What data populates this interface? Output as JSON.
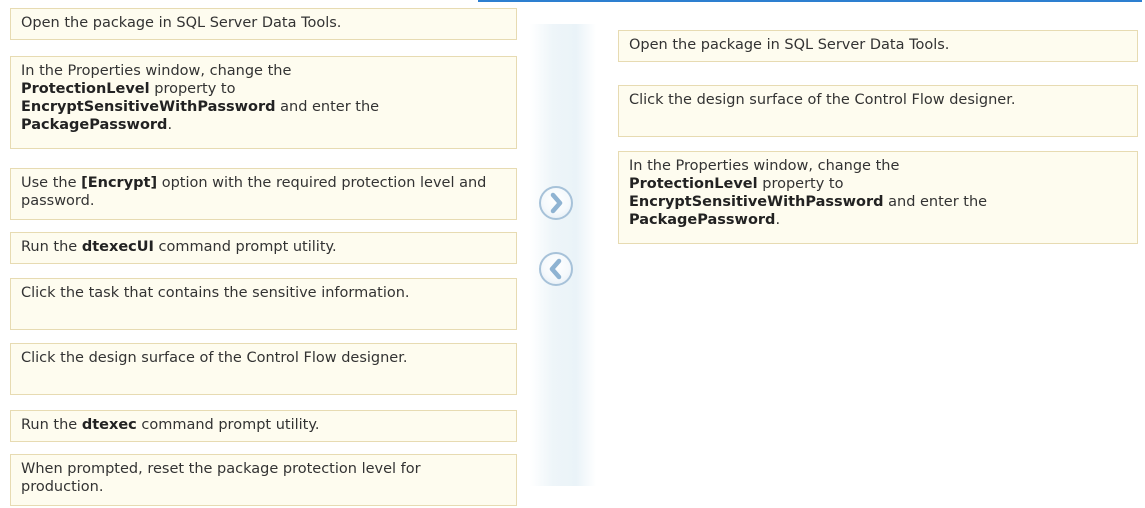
{
  "left_options": [
    {
      "parts": [
        {
          "t": "Open the package in SQL Server Data Tools.",
          "b": false
        }
      ]
    },
    {
      "parts": [
        {
          "t": "In the Properties window, change the ",
          "b": false
        },
        {
          "t": "ProtectionLevel",
          "b": true
        },
        {
          "t": " property to ",
          "b": false
        },
        {
          "t": "EncryptSensitiveWithPassword",
          "b": true
        },
        {
          "t": " and enter the ",
          "b": false
        },
        {
          "t": "PackagePassword",
          "b": true
        },
        {
          "t": ".",
          "b": false
        }
      ]
    },
    {
      "parts": [
        {
          "t": "Use the ",
          "b": false
        },
        {
          "t": "[Encrypt]",
          "b": true
        },
        {
          "t": " option with the required protection level and password.",
          "b": false
        }
      ]
    },
    {
      "parts": [
        {
          "t": "Run the ",
          "b": false
        },
        {
          "t": "dtexecUI",
          "b": true
        },
        {
          "t": " command prompt utility.",
          "b": false
        }
      ]
    },
    {
      "parts": [
        {
          "t": "Click the task that contains the sensitive information.",
          "b": false
        }
      ]
    },
    {
      "parts": [
        {
          "t": "Click the design surface of the Control Flow designer.",
          "b": false
        }
      ]
    },
    {
      "parts": [
        {
          "t": "Run the ",
          "b": false
        },
        {
          "t": "dtexec",
          "b": true
        },
        {
          "t": " command prompt utility.",
          "b": false
        }
      ]
    },
    {
      "parts": [
        {
          "t": "When prompted, reset the package protection level for production.",
          "b": false
        }
      ]
    }
  ],
  "right_answers": [
    {
      "parts": [
        {
          "t": "Open the package in SQL Server Data Tools.",
          "b": false
        }
      ]
    },
    {
      "parts": [
        {
          "t": "Click the design surface of the Control Flow designer.",
          "b": false
        }
      ]
    },
    {
      "parts": [
        {
          "t": "In the Properties window, change the ",
          "b": false
        },
        {
          "t": "ProtectionLevel",
          "b": true
        },
        {
          "t": " property to ",
          "b": false
        },
        {
          "t": "EncryptSensitiveWithPassword",
          "b": true
        },
        {
          "t": " and enter the ",
          "b": false
        },
        {
          "t": "PackagePassword",
          "b": true
        },
        {
          "t": ".",
          "b": false
        }
      ]
    }
  ],
  "nav": {
    "move_right_icon": "chevron-right-icon",
    "move_left_icon": "chevron-left-icon"
  },
  "colors": {
    "card_background": "#fefcef",
    "card_border": "#e7dbb2",
    "button_ring": "#a7c2d9",
    "top_rule": "#2d7fd0"
  }
}
